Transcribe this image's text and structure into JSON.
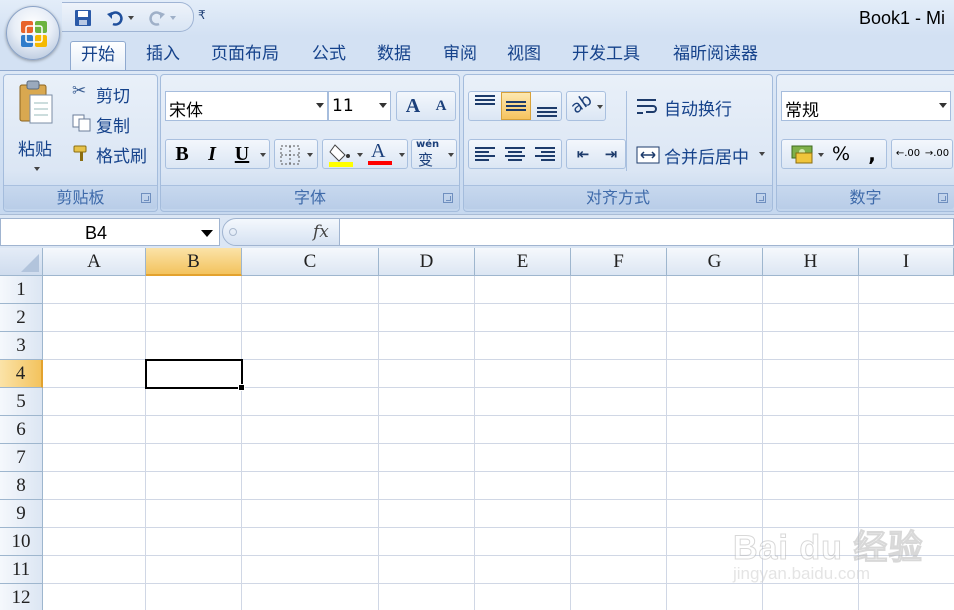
{
  "app": {
    "title": "Book1 - Mi",
    "quick_access": {
      "save_icon": "save-icon",
      "undo_icon": "undo-icon",
      "redo_icon": "redo-icon",
      "customize_glyph": "₹"
    }
  },
  "tabs": [
    {
      "label": "开始",
      "active": true
    },
    {
      "label": "插入"
    },
    {
      "label": "页面布局"
    },
    {
      "label": "公式"
    },
    {
      "label": "数据"
    },
    {
      "label": "审阅"
    },
    {
      "label": "视图"
    },
    {
      "label": "开发工具"
    },
    {
      "label": "福昕阅读器"
    }
  ],
  "ribbon": {
    "clipboard": {
      "group_label": "剪贴板",
      "paste": "粘贴",
      "cut": "剪切",
      "copy": "复制",
      "format_painter": "格式刷"
    },
    "font": {
      "group_label": "字体",
      "font_name": "宋体",
      "font_size": "11",
      "grow": "A",
      "shrink": "A",
      "bold": "B",
      "italic": "I",
      "underline": "U",
      "font_color_letter": "A",
      "phonetic": "wén",
      "phonetic_char": "变",
      "fill_color": "#ffff00",
      "font_color": "#ff0000"
    },
    "alignment": {
      "group_label": "对齐方式",
      "wrap_text": "自动换行",
      "merge_center": "合并后居中"
    },
    "number": {
      "group_label": "数字",
      "format": "常规",
      "percent": "%",
      "comma": ",",
      "inc_decimal": ".00",
      "dec_decimal": ".00"
    }
  },
  "formula_bar": {
    "name_box": "B4",
    "fx": "fx",
    "formula": ""
  },
  "grid": {
    "columns": [
      "A",
      "B",
      "C",
      "D",
      "E",
      "F",
      "G",
      "H",
      "I"
    ],
    "rows": [
      "1",
      "2",
      "3",
      "4",
      "5",
      "6",
      "7",
      "8",
      "9",
      "10",
      "11",
      "12"
    ],
    "selected_column": "B",
    "selected_row": "4"
  },
  "watermark": {
    "main": "Bai du 经验",
    "sub": "jingyan.baidu.com"
  },
  "colors": {
    "accent": "#15428b",
    "selection": "#f3c35e",
    "ribbon_bg": "#dbe6f4"
  }
}
